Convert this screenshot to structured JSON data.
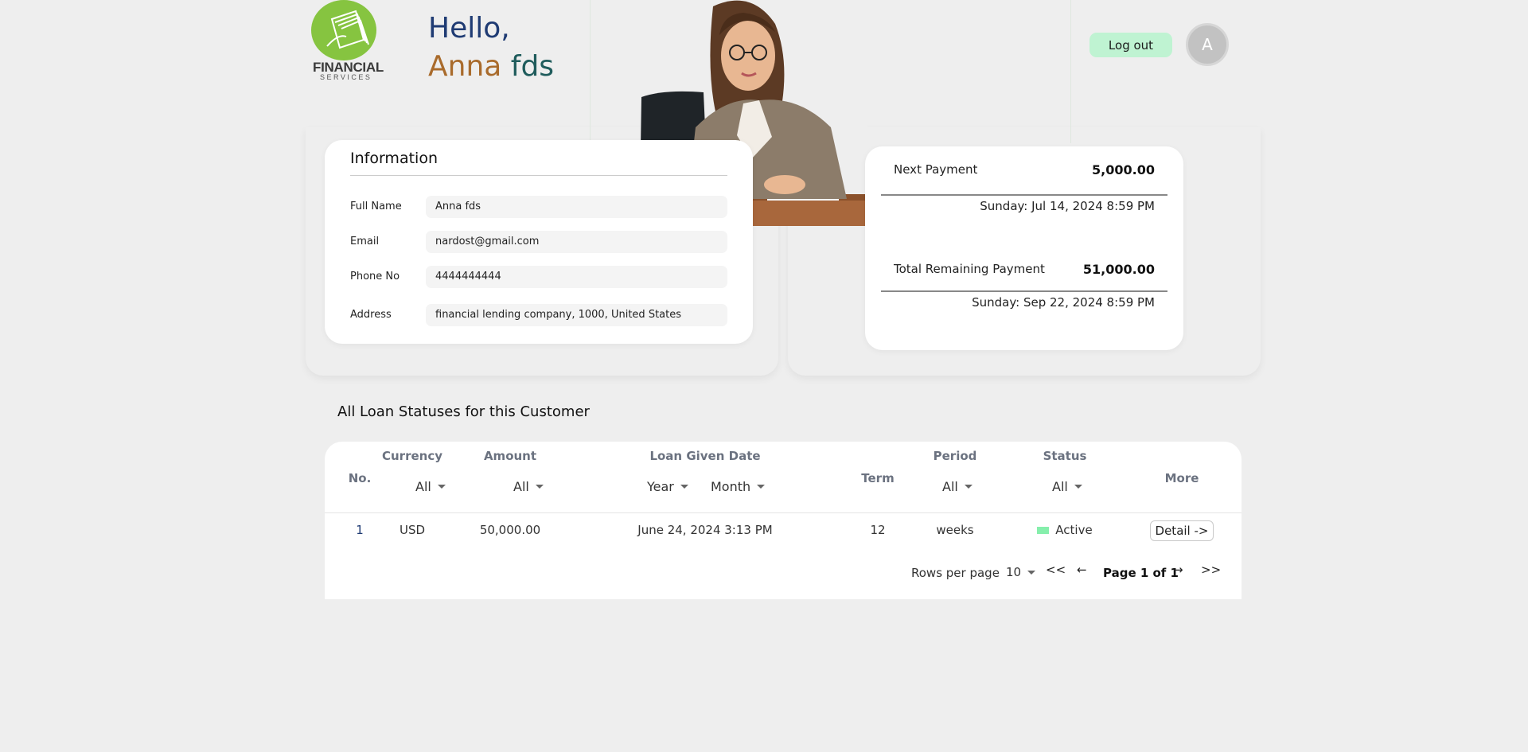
{
  "brand": {
    "logo_primary": "FINANCIAL",
    "logo_secondary": "SERVICES",
    "logo_color": "#86c440"
  },
  "greeting": {
    "hello": "Hello,",
    "first_name": "Anna",
    "last_name": "fds"
  },
  "header": {
    "logout_label": "Log out",
    "avatar_initial": "A",
    "logout_color": "#bff3d2"
  },
  "info": {
    "title": "Information",
    "fields": [
      {
        "label": "Full Name",
        "value": "Anna fds"
      },
      {
        "label": "Email",
        "value": "nardost@gmail.com"
      },
      {
        "label": "Phone No",
        "value": "4444444444"
      },
      {
        "label": "Address",
        "value": "financial lending company, 1000, United States"
      }
    ]
  },
  "payments": {
    "next": {
      "label": "Next Payment",
      "amount": "5,000.00",
      "date": "Sunday: Jul 14, 2024 8:59 PM"
    },
    "total": {
      "label": "Total Remaining Payment",
      "amount": "51,000.00",
      "date": "Sunday: Sep 22, 2024 8:59 PM"
    }
  },
  "loans": {
    "heading": "All Loan Statuses for this Customer",
    "headers": {
      "no": "No.",
      "currency": "Currency",
      "amount": "Amount",
      "given_date": "Loan Given Date",
      "term": "Term",
      "period": "Period",
      "status": "Status",
      "more": "More"
    },
    "filters": {
      "currency": "All",
      "amount": "All",
      "year": "Year",
      "month": "Month",
      "period": "All",
      "status": "All"
    },
    "rows": [
      {
        "no": "1",
        "currency": "USD",
        "amount": "50,000.00",
        "given_date": "June 24, 2024 3:13 PM",
        "term": "12",
        "period": "weeks",
        "status": "Active",
        "detail_label": "Detail ->"
      }
    ],
    "status_active_color": "#86efac"
  },
  "pagination": {
    "rows_per_page_label": "Rows per page",
    "rows_per_page_value": "10",
    "first": "<<",
    "prev": "←",
    "page_label": "Page 1 of 1",
    "next": "→",
    "last": ">>"
  }
}
